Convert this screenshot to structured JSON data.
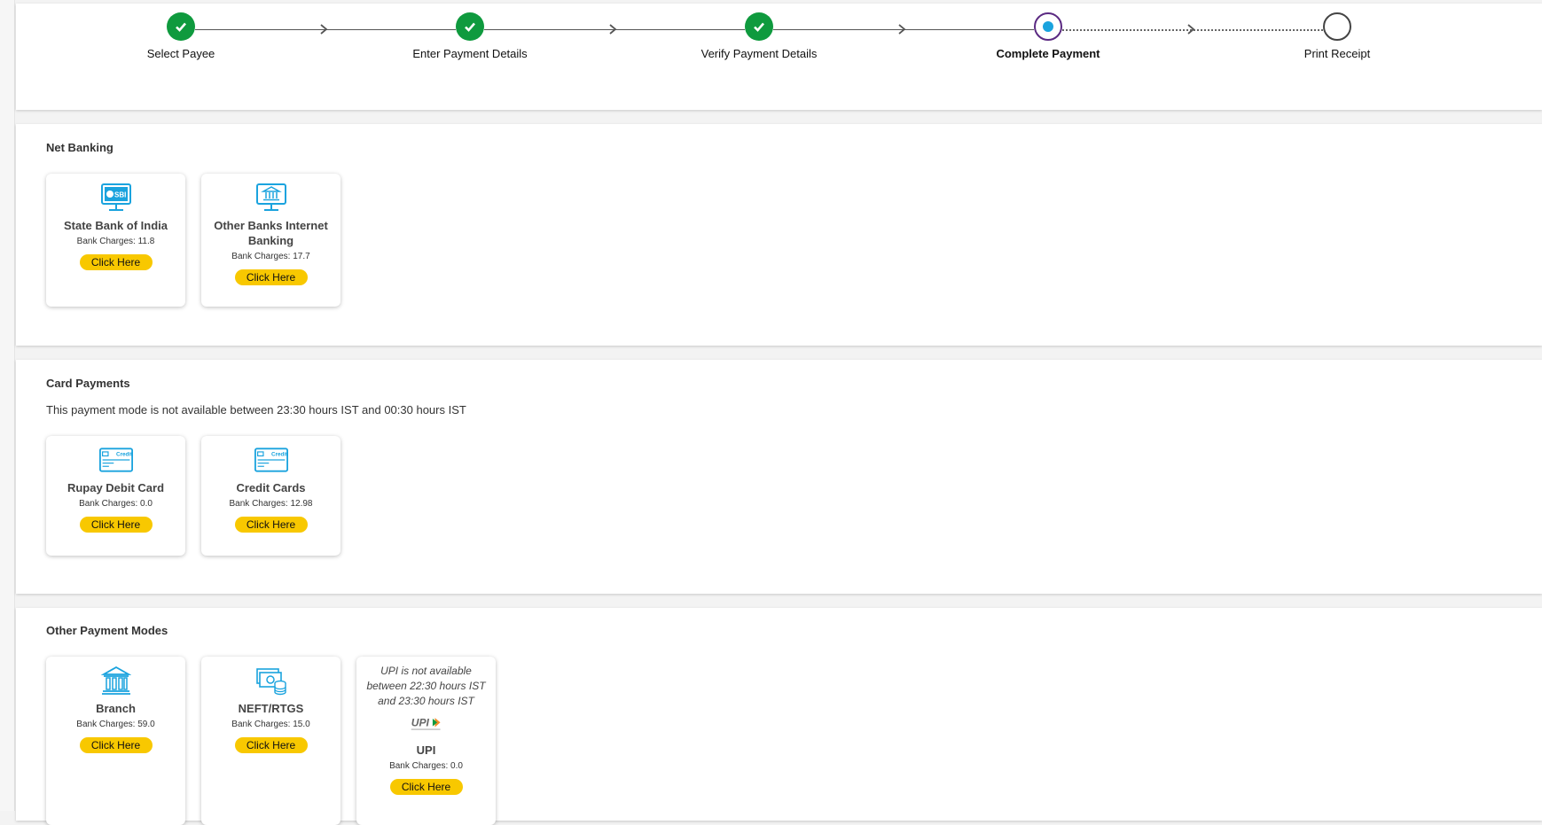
{
  "stepper": {
    "steps": [
      {
        "label": "Select Payee",
        "state": "done"
      },
      {
        "label": "Enter Payment Details",
        "state": "done"
      },
      {
        "label": "Verify Payment Details",
        "state": "done"
      },
      {
        "label": "Complete Payment",
        "state": "current"
      },
      {
        "label": "Print Receipt",
        "state": "pending"
      }
    ]
  },
  "net_banking": {
    "title": "Net Banking",
    "cards": [
      {
        "name": "State Bank of India",
        "charges": "Bank Charges: 11.8",
        "button": "Click Here",
        "icon": "sbi-monitor-icon"
      },
      {
        "name": "Other Banks Internet Banking",
        "charges": "Bank Charges: 17.7",
        "button": "Click Here",
        "icon": "bank-monitor-icon"
      }
    ]
  },
  "card_payments": {
    "title": "Card Payments",
    "notice": "This payment mode is not available between 23:30 hours IST and 00:30 hours IST",
    "cards": [
      {
        "name": "Rupay Debit Card",
        "charges": "Bank Charges: 0.0",
        "button": "Click Here",
        "icon": "credit-card-icon"
      },
      {
        "name": "Credit Cards",
        "charges": "Bank Charges: 12.98",
        "button": "Click Here",
        "icon": "credit-card-icon"
      }
    ]
  },
  "other_modes": {
    "title": "Other Payment Modes",
    "cards": [
      {
        "name": "Branch",
        "charges": "Bank Charges: 59.0",
        "button": "Click Here",
        "icon": "bank-building-icon"
      },
      {
        "name": "NEFT/RTGS",
        "charges": "Bank Charges: 15.0",
        "button": "Click Here",
        "icon": "cash-coins-icon"
      },
      {
        "name": "UPI",
        "charges": "Bank Charges: 0.0",
        "button": "Click Here",
        "icon": "upi-logo-icon",
        "note": "UPI is not available between 22:30 hours IST and 23:30 hours IST",
        "logo_text": "UPI"
      }
    ]
  },
  "colors": {
    "done": "#0f9a3e",
    "current_ring": "#5b2a82",
    "current_dot": "#1aa3de",
    "button": "#f8c800",
    "icon": "#1aa3de"
  }
}
